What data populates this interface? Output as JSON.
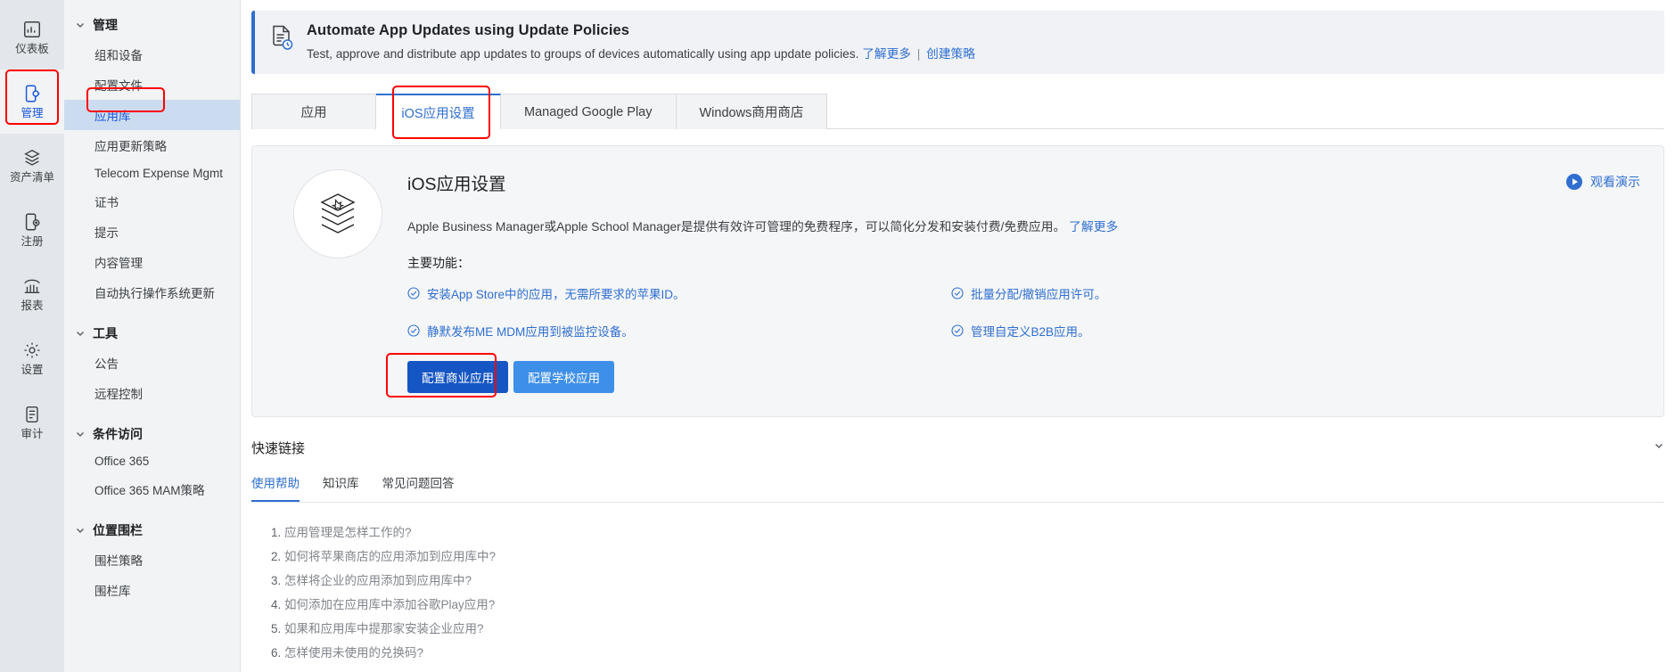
{
  "rail": {
    "items": [
      {
        "label": "仪表板",
        "icon": "dashboard-icon",
        "active": false
      },
      {
        "label": "管理",
        "icon": "manage-device-icon",
        "active": true
      },
      {
        "label": "资产清单",
        "icon": "inventory-layers-icon",
        "active": false
      },
      {
        "label": "注册",
        "icon": "enroll-device-icon",
        "active": false
      },
      {
        "label": "报表",
        "icon": "reports-bar-icon",
        "active": false
      },
      {
        "label": "设置",
        "icon": "gear-icon",
        "active": false
      },
      {
        "label": "审计",
        "icon": "clipboard-icon",
        "active": false
      }
    ]
  },
  "sidebar": {
    "groups": [
      {
        "label": "管理",
        "items": [
          "组和设备",
          "配置文件",
          "应用库",
          "应用更新策略",
          "Telecom Expense Mgmt",
          "证书",
          "提示",
          "内容管理",
          "自动执行操作系统更新"
        ],
        "selected_index": 2
      },
      {
        "label": "工具",
        "items": [
          "公告",
          "远程控制"
        ],
        "selected_index": -1
      },
      {
        "label": "条件访问",
        "items": [
          "Office 365",
          "Office 365 MAM策略"
        ],
        "selected_index": -1
      },
      {
        "label": "位置围栏",
        "items": [
          "围栏策略",
          "围栏库"
        ],
        "selected_index": -1
      }
    ]
  },
  "banner": {
    "title": "Automate App Updates using Update Policies",
    "description": "Test, approve and distribute app updates to groups of devices automatically using app update policies.",
    "link_learn_more": "了解更多",
    "separator": "|",
    "link_create_policy": "创建策略"
  },
  "tabs": [
    {
      "label": "应用",
      "active": false
    },
    {
      "label": "iOS应用设置",
      "active": true
    },
    {
      "label": "Managed Google Play",
      "active": false
    },
    {
      "label": "Windows商用商店",
      "active": false
    }
  ],
  "hero": {
    "title": "iOS应用设置",
    "description": "Apple Business Manager或Apple School Manager是提供有效许可管理的免费程序，可以简化分发和安装付费/免费应用。",
    "description_link": "了解更多",
    "features_label": "主要功能：",
    "features": [
      "安装App Store中的应用，无需所要求的苹果ID。",
      "批量分配/撤销应用许可。",
      "静默发布ME MDM应用到被监控设备。",
      "管理自定义B2B应用。"
    ],
    "primary_button": "配置商业应用",
    "secondary_button": "配置学校应用",
    "demo_link": "观看演示"
  },
  "quick_links": {
    "title": "快速链接",
    "tabs": [
      {
        "label": "使用帮助",
        "active": true
      },
      {
        "label": "知识库",
        "active": false
      },
      {
        "label": "常见问题回答",
        "active": false
      }
    ],
    "items": [
      "应用管理是怎样工作的?",
      "如何将苹果商店的应用添加到应用库中?",
      "怎样将企业的应用添加到应用库中?",
      "如何添加在应用库中添加谷歌Play应用?",
      "如果和应用库中提那家安装企业应用?",
      "怎样使用未使用的兑换码?"
    ]
  },
  "colors": {
    "accent": "#2f6fd0",
    "primary_button": "#1656c4",
    "secondary_button": "#3e8fe8",
    "highlight": "#ff0000"
  }
}
